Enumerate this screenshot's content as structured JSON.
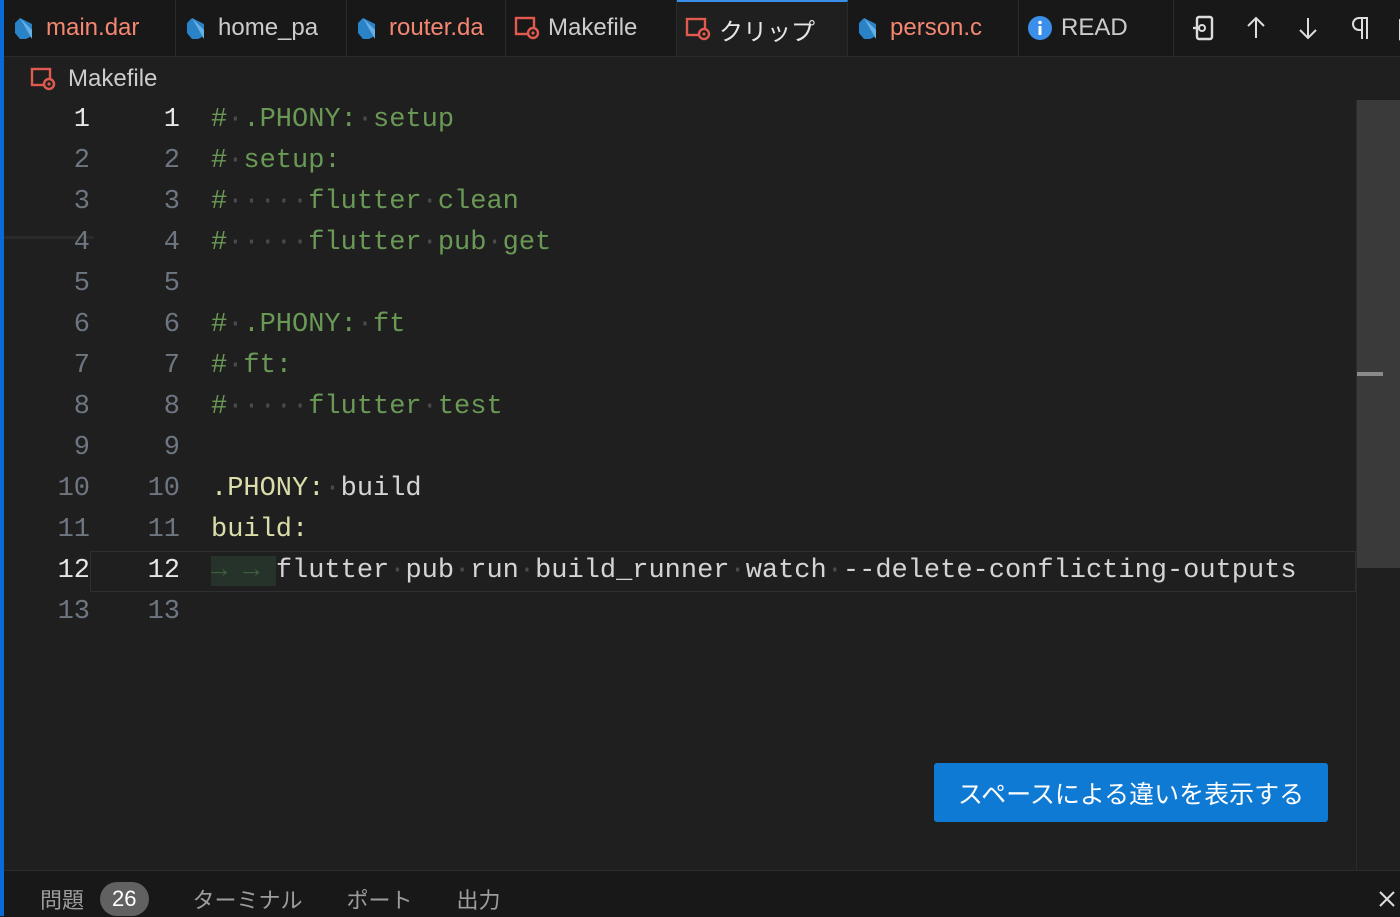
{
  "tabs": [
    {
      "label": "main.dar",
      "icon": "dart-icon",
      "style": "err"
    },
    {
      "label": "home_pa",
      "icon": "dart-icon",
      "style": "norm"
    },
    {
      "label": "router.da",
      "icon": "dart-icon",
      "style": "err"
    },
    {
      "label": "Makefile",
      "icon": "makefile-icon",
      "style": "norm"
    },
    {
      "label": "クリップ",
      "icon": "makefile-icon",
      "style": "bright",
      "active": true
    },
    {
      "label": "person.c",
      "icon": "dart-icon",
      "style": "err"
    },
    {
      "label": "READ",
      "icon": "info-icon",
      "style": "norm"
    }
  ],
  "breadcrumb": {
    "file": "Makefile"
  },
  "lines": [
    {
      "left": "1",
      "right": "1",
      "tokens": [
        {
          "t": "#",
          "c": "cmt"
        },
        {
          "t": "·",
          "c": "dot"
        },
        {
          "t": ".PHONY:",
          "c": "cmt"
        },
        {
          "t": "·",
          "c": "dot"
        },
        {
          "t": "setup",
          "c": "cmt"
        }
      ]
    },
    {
      "left": "2",
      "right": "2",
      "tokens": [
        {
          "t": "#",
          "c": "cmt"
        },
        {
          "t": "·",
          "c": "dot"
        },
        {
          "t": "setup:",
          "c": "cmt"
        }
      ]
    },
    {
      "left": "3",
      "right": "3",
      "tokens": [
        {
          "t": "#",
          "c": "cmt"
        },
        {
          "t": "·····",
          "c": "dot"
        },
        {
          "t": "flutter",
          "c": "cmt"
        },
        {
          "t": "·",
          "c": "dot"
        },
        {
          "t": "clean",
          "c": "cmt"
        }
      ]
    },
    {
      "left": "4",
      "right": "4",
      "tokens": [
        {
          "t": "#",
          "c": "cmt"
        },
        {
          "t": "·····",
          "c": "dot"
        },
        {
          "t": "flutter",
          "c": "cmt"
        },
        {
          "t": "·",
          "c": "dot"
        },
        {
          "t": "pub",
          "c": "cmt"
        },
        {
          "t": "·",
          "c": "dot"
        },
        {
          "t": "get",
          "c": "cmt"
        }
      ]
    },
    {
      "left": "5",
      "right": "5",
      "tokens": []
    },
    {
      "left": "6",
      "right": "6",
      "tokens": [
        {
          "t": "#",
          "c": "cmt"
        },
        {
          "t": "·",
          "c": "dot"
        },
        {
          "t": ".PHONY:",
          "c": "cmt"
        },
        {
          "t": "·",
          "c": "dot"
        },
        {
          "t": "ft",
          "c": "cmt"
        }
      ]
    },
    {
      "left": "7",
      "right": "7",
      "tokens": [
        {
          "t": "#",
          "c": "cmt"
        },
        {
          "t": "·",
          "c": "dot"
        },
        {
          "t": "ft:",
          "c": "cmt"
        }
      ]
    },
    {
      "left": "8",
      "right": "8",
      "tokens": [
        {
          "t": "#",
          "c": "cmt"
        },
        {
          "t": "·····",
          "c": "dot"
        },
        {
          "t": "flutter",
          "c": "cmt"
        },
        {
          "t": "·",
          "c": "dot"
        },
        {
          "t": "test",
          "c": "cmt"
        }
      ]
    },
    {
      "left": "9",
      "right": "9",
      "tokens": []
    },
    {
      "left": "10",
      "right": "10",
      "tokens": [
        {
          "t": ".PHONY:",
          "c": "tgt"
        },
        {
          "t": "·",
          "c": "dot"
        },
        {
          "t": "build",
          "c": "plain"
        }
      ]
    },
    {
      "left": "11",
      "right": "11",
      "tokens": [
        {
          "t": "build:",
          "c": "tgt"
        }
      ]
    },
    {
      "left": "12",
      "right": "12",
      "current": true,
      "tokens": [
        {
          "t": "→ ",
          "c": "tabglyph"
        },
        {
          "t": "→ ",
          "c": "tabglyph"
        },
        {
          "t": "flutter",
          "c": "plain"
        },
        {
          "t": "·",
          "c": "dot"
        },
        {
          "t": "pub",
          "c": "plain"
        },
        {
          "t": "·",
          "c": "dot"
        },
        {
          "t": "run",
          "c": "plain"
        },
        {
          "t": "·",
          "c": "dot"
        },
        {
          "t": "build_runner",
          "c": "plain"
        },
        {
          "t": "·",
          "c": "dot"
        },
        {
          "t": "watch",
          "c": "plain"
        },
        {
          "t": "·",
          "c": "dot"
        },
        {
          "t": "--delete-conflicting-outputs",
          "c": "plain"
        }
      ]
    },
    {
      "left": "13",
      "right": "13",
      "tokens": []
    }
  ],
  "show_whitespace_button": "スペースによる違いを表示する",
  "panel": {
    "tabs": [
      "問題",
      "ターミナル",
      "ポート",
      "出力"
    ],
    "problems_count": "26"
  }
}
